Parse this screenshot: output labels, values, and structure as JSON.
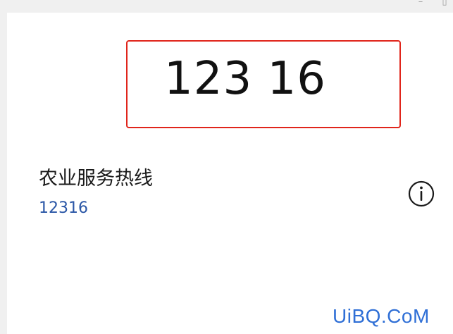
{
  "window_controls": {
    "minimize_glyph": "–",
    "maximize_glyph": "▯"
  },
  "dialer": {
    "number_display": "123 16"
  },
  "contact": {
    "name": "农业服务热线",
    "number": "12316",
    "info_icon": "info-circle-icon"
  },
  "watermark": {
    "text": "UiBQ.CoM"
  },
  "colors": {
    "highlight_border": "#e0251b",
    "number_link": "#2a56a6",
    "watermark": "#2f6fd6"
  }
}
